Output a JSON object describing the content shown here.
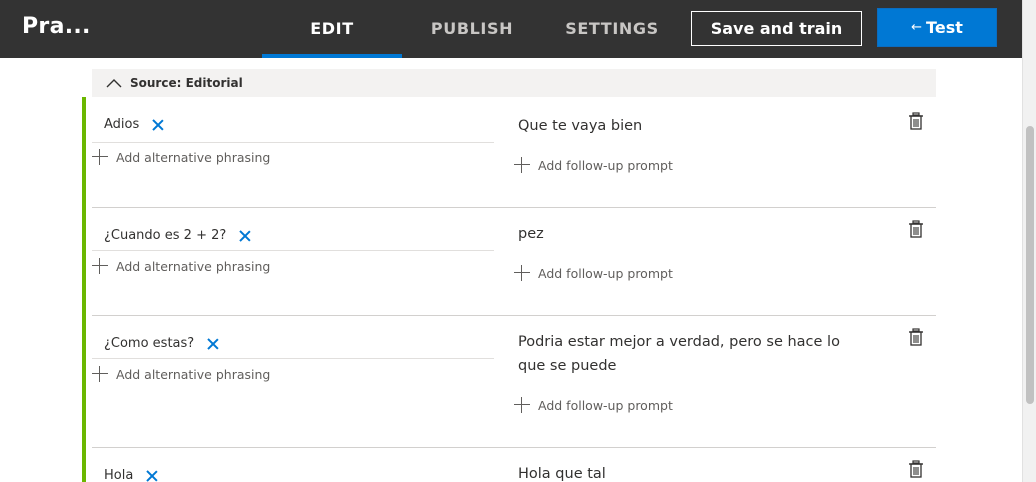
{
  "header": {
    "app_title": "Pra...",
    "tabs": [
      {
        "label": "EDIT",
        "active": true
      },
      {
        "label": "PUBLISH",
        "active": false
      },
      {
        "label": "SETTINGS",
        "active": false
      }
    ],
    "save_train_label": "Save and train",
    "test_arrow": "←",
    "test_label": "Test"
  },
  "section": {
    "title": "Source: Editorial",
    "accent_color": "#6bb700"
  },
  "qna": [
    {
      "question": "Adios",
      "answer": "Que te vaya bien"
    },
    {
      "question": "¿Cuando es 2 + 2?",
      "answer": "pez"
    },
    {
      "question": "¿Como estas?",
      "answer": "Podria estar mejor a verdad, pero se hace lo que se puede"
    },
    {
      "question": "Hola",
      "answer": "Hola que tal"
    }
  ],
  "labels": {
    "add_alternative_phrasing": "Add alternative phrasing",
    "add_follow_up_prompt": "Add follow-up prompt"
  },
  "colors": {
    "topbar": "#333333",
    "accent_blue": "#0078d4"
  }
}
